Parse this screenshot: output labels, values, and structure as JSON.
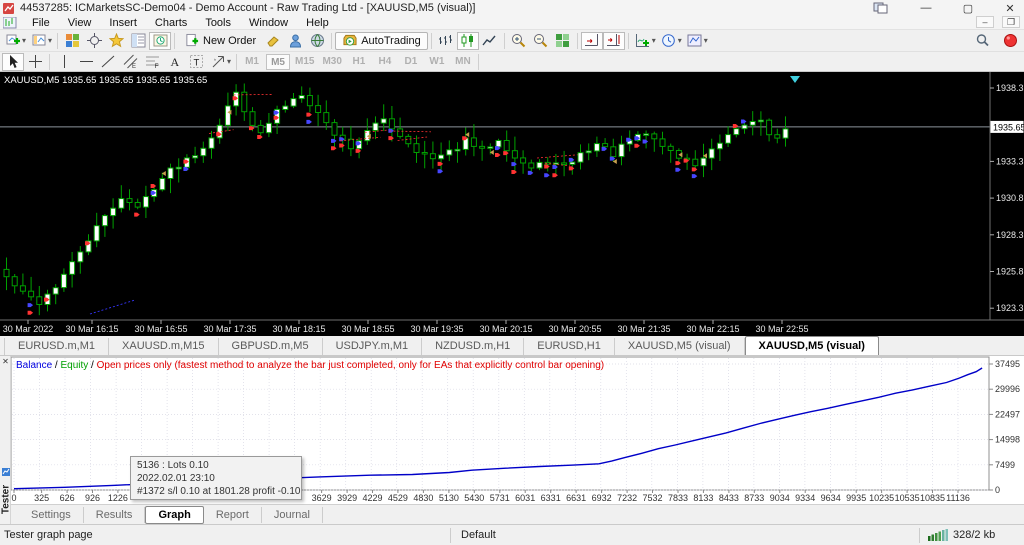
{
  "window": {
    "title": "44537285: ICMarketsSC-Demo04 - Demo Account - Raw Trading Ltd - [XAUUSD,M5 (visual)]",
    "controls": {
      "minimize": "—",
      "maximize": "▢",
      "close": "✕",
      "child_minimize": "–",
      "child_restore": "❐"
    }
  },
  "menu": {
    "items": [
      "File",
      "View",
      "Insert",
      "Charts",
      "Tools",
      "Window",
      "Help"
    ]
  },
  "toolbar": {
    "new_order_label": "New Order",
    "autotrading_label": "AutoTrading"
  },
  "timeframes": {
    "items": [
      "M1",
      "M5",
      "M15",
      "M30",
      "H1",
      "H4",
      "D1",
      "W1",
      "MN"
    ],
    "active": "M5"
  },
  "chart": {
    "symbol_info": "XAUUSD,M5  1935.65 1935.65 1935.65 1935.65",
    "price_axis": {
      "ticks": [
        "1938.3",
        "1933.3",
        "1930.8",
        "1928.3",
        "1925.8",
        "1923.3"
      ],
      "current": "1935.65"
    },
    "time_axis": [
      "30 Mar 2022",
      "30 Mar 16:15",
      "30 Mar 16:55",
      "30 Mar 17:35",
      "30 Mar 18:15",
      "30 Mar 18:55",
      "30 Mar 19:35",
      "30 Mar 20:15",
      "30 Mar 20:55",
      "30 Mar 21:35",
      "30 Mar 22:15",
      "30 Mar 22:55"
    ],
    "colors": {
      "bull": "#FFFFFF",
      "bear": "#000000",
      "outline": "#00A000",
      "bg": "#000000",
      "price_line": "#8c949c",
      "buy_arrow": "#4646ff",
      "sell_arrow": "#ff3232",
      "exit_arrow": "#c8a050",
      "axis_text": "#e8e8e8"
    },
    "candle_close_anchors": [
      [
        0,
        1925.4
      ],
      [
        2,
        1924.3
      ],
      [
        4,
        1923.7
      ],
      [
        6,
        1924.8
      ],
      [
        8,
        1926.3
      ],
      [
        10,
        1928.0
      ],
      [
        12,
        1929.5
      ],
      [
        14,
        1930.9
      ],
      [
        16,
        1930.1
      ],
      [
        18,
        1931.6
      ],
      [
        20,
        1932.7
      ],
      [
        22,
        1933.5
      ],
      [
        24,
        1934.3
      ],
      [
        26,
        1935.9
      ],
      [
        28,
        1938.0
      ],
      [
        29,
        1936.9
      ],
      [
        30,
        1935.9
      ],
      [
        31,
        1935.1
      ],
      [
        33,
        1936.7
      ],
      [
        35,
        1937.6
      ],
      [
        36,
        1938.0
      ],
      [
        38,
        1936.6
      ],
      [
        40,
        1935.2
      ],
      [
        42,
        1934.3
      ],
      [
        44,
        1935.3
      ],
      [
        46,
        1936.2
      ],
      [
        48,
        1935.1
      ],
      [
        50,
        1934.1
      ],
      [
        52,
        1933.4
      ],
      [
        54,
        1933.9
      ],
      [
        56,
        1934.7
      ],
      [
        58,
        1934.0
      ],
      [
        60,
        1934.9
      ],
      [
        62,
        1933.6
      ],
      [
        64,
        1932.8
      ],
      [
        66,
        1933.3
      ],
      [
        68,
        1932.9
      ],
      [
        70,
        1933.8
      ],
      [
        72,
        1934.5
      ],
      [
        74,
        1933.8
      ],
      [
        76,
        1934.7
      ],
      [
        78,
        1935.2
      ],
      [
        80,
        1934.4
      ],
      [
        82,
        1933.6
      ],
      [
        84,
        1933.1
      ],
      [
        86,
        1934.0
      ],
      [
        88,
        1934.9
      ],
      [
        90,
        1935.8
      ],
      [
        92,
        1936.2
      ],
      [
        93,
        1935.3
      ],
      [
        94,
        1934.8
      ],
      [
        95,
        1935.6
      ]
    ]
  },
  "chart_tabs": {
    "items": [
      "EURUSD.m,M1",
      "XAUUSD.m,M15",
      "GBPUSD.m,M5",
      "USDJPY.m,M1",
      "NZDUSD.m,H1",
      "EURUSD,H1",
      "XAUUSD,M5 (visual)",
      "XAUUSD,M5 (visual)"
    ],
    "active_index": 7
  },
  "tester": {
    "panel_label": "Tester",
    "legend": {
      "balance": "Balance",
      "sep1": " / ",
      "equity": "Equity",
      "sep2": " / ",
      "note": "Open prices only (fastest method to analyze the bar just completed, only for EAs that explicitly control bar opening)"
    },
    "legend_colors": {
      "balance": "#0000e0",
      "equity": "#00a000",
      "note": "#e00000"
    },
    "graph": {
      "type": "line",
      "title": "Balance",
      "y_ticks": [
        37495,
        29996,
        22497,
        14998,
        7499,
        0
      ],
      "x_ticks": [
        0,
        325,
        626,
        926,
        1226,
        3629,
        3929,
        4229,
        4529,
        4830,
        5130,
        5430,
        5731,
        6031,
        6331,
        6631,
        6932,
        7232,
        7532,
        7833,
        8133,
        8433,
        8733,
        9034,
        9334,
        9634,
        9935,
        10235,
        10535,
        10835,
        11136
      ],
      "x_max": 11420,
      "y_max": 37495,
      "line_color": "#0000c8",
      "balance_points": [
        [
          0,
          400
        ],
        [
          600,
          800
        ],
        [
          1200,
          1400
        ],
        [
          1800,
          2100
        ],
        [
          2400,
          2700
        ],
        [
          3000,
          3300
        ],
        [
          3600,
          3900
        ],
        [
          4200,
          4400
        ],
        [
          4700,
          4600
        ],
        [
          5136,
          5200
        ],
        [
          5400,
          5900
        ],
        [
          5800,
          6500
        ],
        [
          6200,
          7000
        ],
        [
          6600,
          7400
        ],
        [
          6900,
          7800
        ],
        [
          7050,
          8600
        ],
        [
          7200,
          9600
        ],
        [
          7400,
          10900
        ],
        [
          7600,
          12300
        ],
        [
          7800,
          13400
        ],
        [
          8000,
          14600
        ],
        [
          8200,
          15800
        ],
        [
          8400,
          17000
        ],
        [
          8600,
          18400
        ],
        [
          8800,
          19800
        ],
        [
          9000,
          21000
        ],
        [
          9200,
          22200
        ],
        [
          9400,
          23300
        ],
        [
          9600,
          24300
        ],
        [
          9800,
          25400
        ],
        [
          10000,
          26500
        ],
        [
          10200,
          27600
        ],
        [
          10400,
          28800
        ],
        [
          10600,
          29800
        ],
        [
          10800,
          30900
        ],
        [
          11000,
          32000
        ],
        [
          11150,
          33300
        ],
        [
          11250,
          34300
        ],
        [
          11350,
          35200
        ],
        [
          11420,
          36300
        ]
      ]
    },
    "tooltip": {
      "line1": "5136 : Lots 0.10",
      "line2": "2022.02.01 23:10",
      "line3": "#1372 s/l 0.10 at 1801.28 profit -0.10"
    },
    "tabs": {
      "items": [
        "Settings",
        "Results",
        "Graph",
        "Report",
        "Journal"
      ],
      "active": "Graph"
    }
  },
  "status_bar": {
    "left": "Tester graph page",
    "center": "Default",
    "right": "328/2 kb"
  }
}
